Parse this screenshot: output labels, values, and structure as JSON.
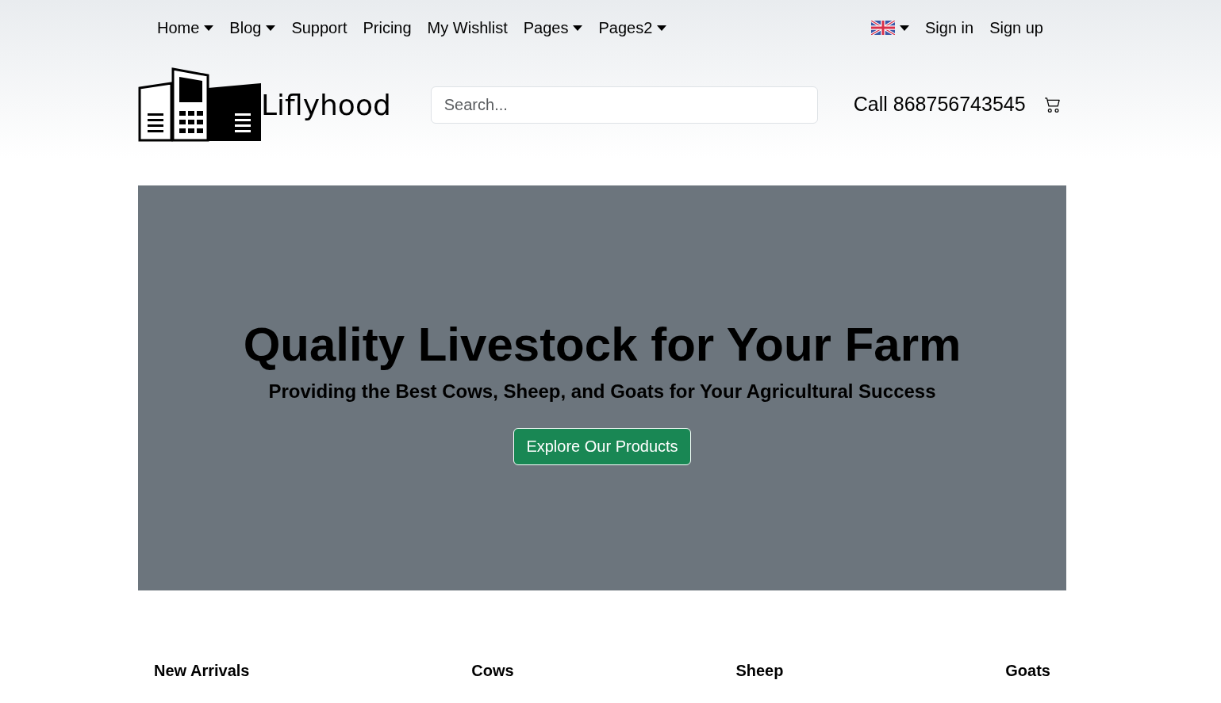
{
  "nav": {
    "items": [
      {
        "label": "Home",
        "dropdown": true
      },
      {
        "label": "Blog",
        "dropdown": true
      },
      {
        "label": "Support",
        "dropdown": false
      },
      {
        "label": "Pricing",
        "dropdown": false
      },
      {
        "label": "My Wishlist",
        "dropdown": false
      },
      {
        "label": "Pages",
        "dropdown": true
      },
      {
        "label": "Pages2",
        "dropdown": true
      }
    ],
    "auth": [
      "Sign in",
      "Sign up"
    ]
  },
  "header": {
    "brand": "Liflyhood",
    "search": {
      "placeholder": "Search..."
    },
    "phone": "Call 868756743545"
  },
  "hero": {
    "title": "Quality Livestock for Your Farm",
    "subtitle": "Providing the Best Cows, Sheep, and Goats for Your Agricultural Success",
    "button": "Explore Our Products"
  },
  "categories": [
    "New Arrivals",
    "Cows",
    "Sheep",
    "Goats"
  ]
}
